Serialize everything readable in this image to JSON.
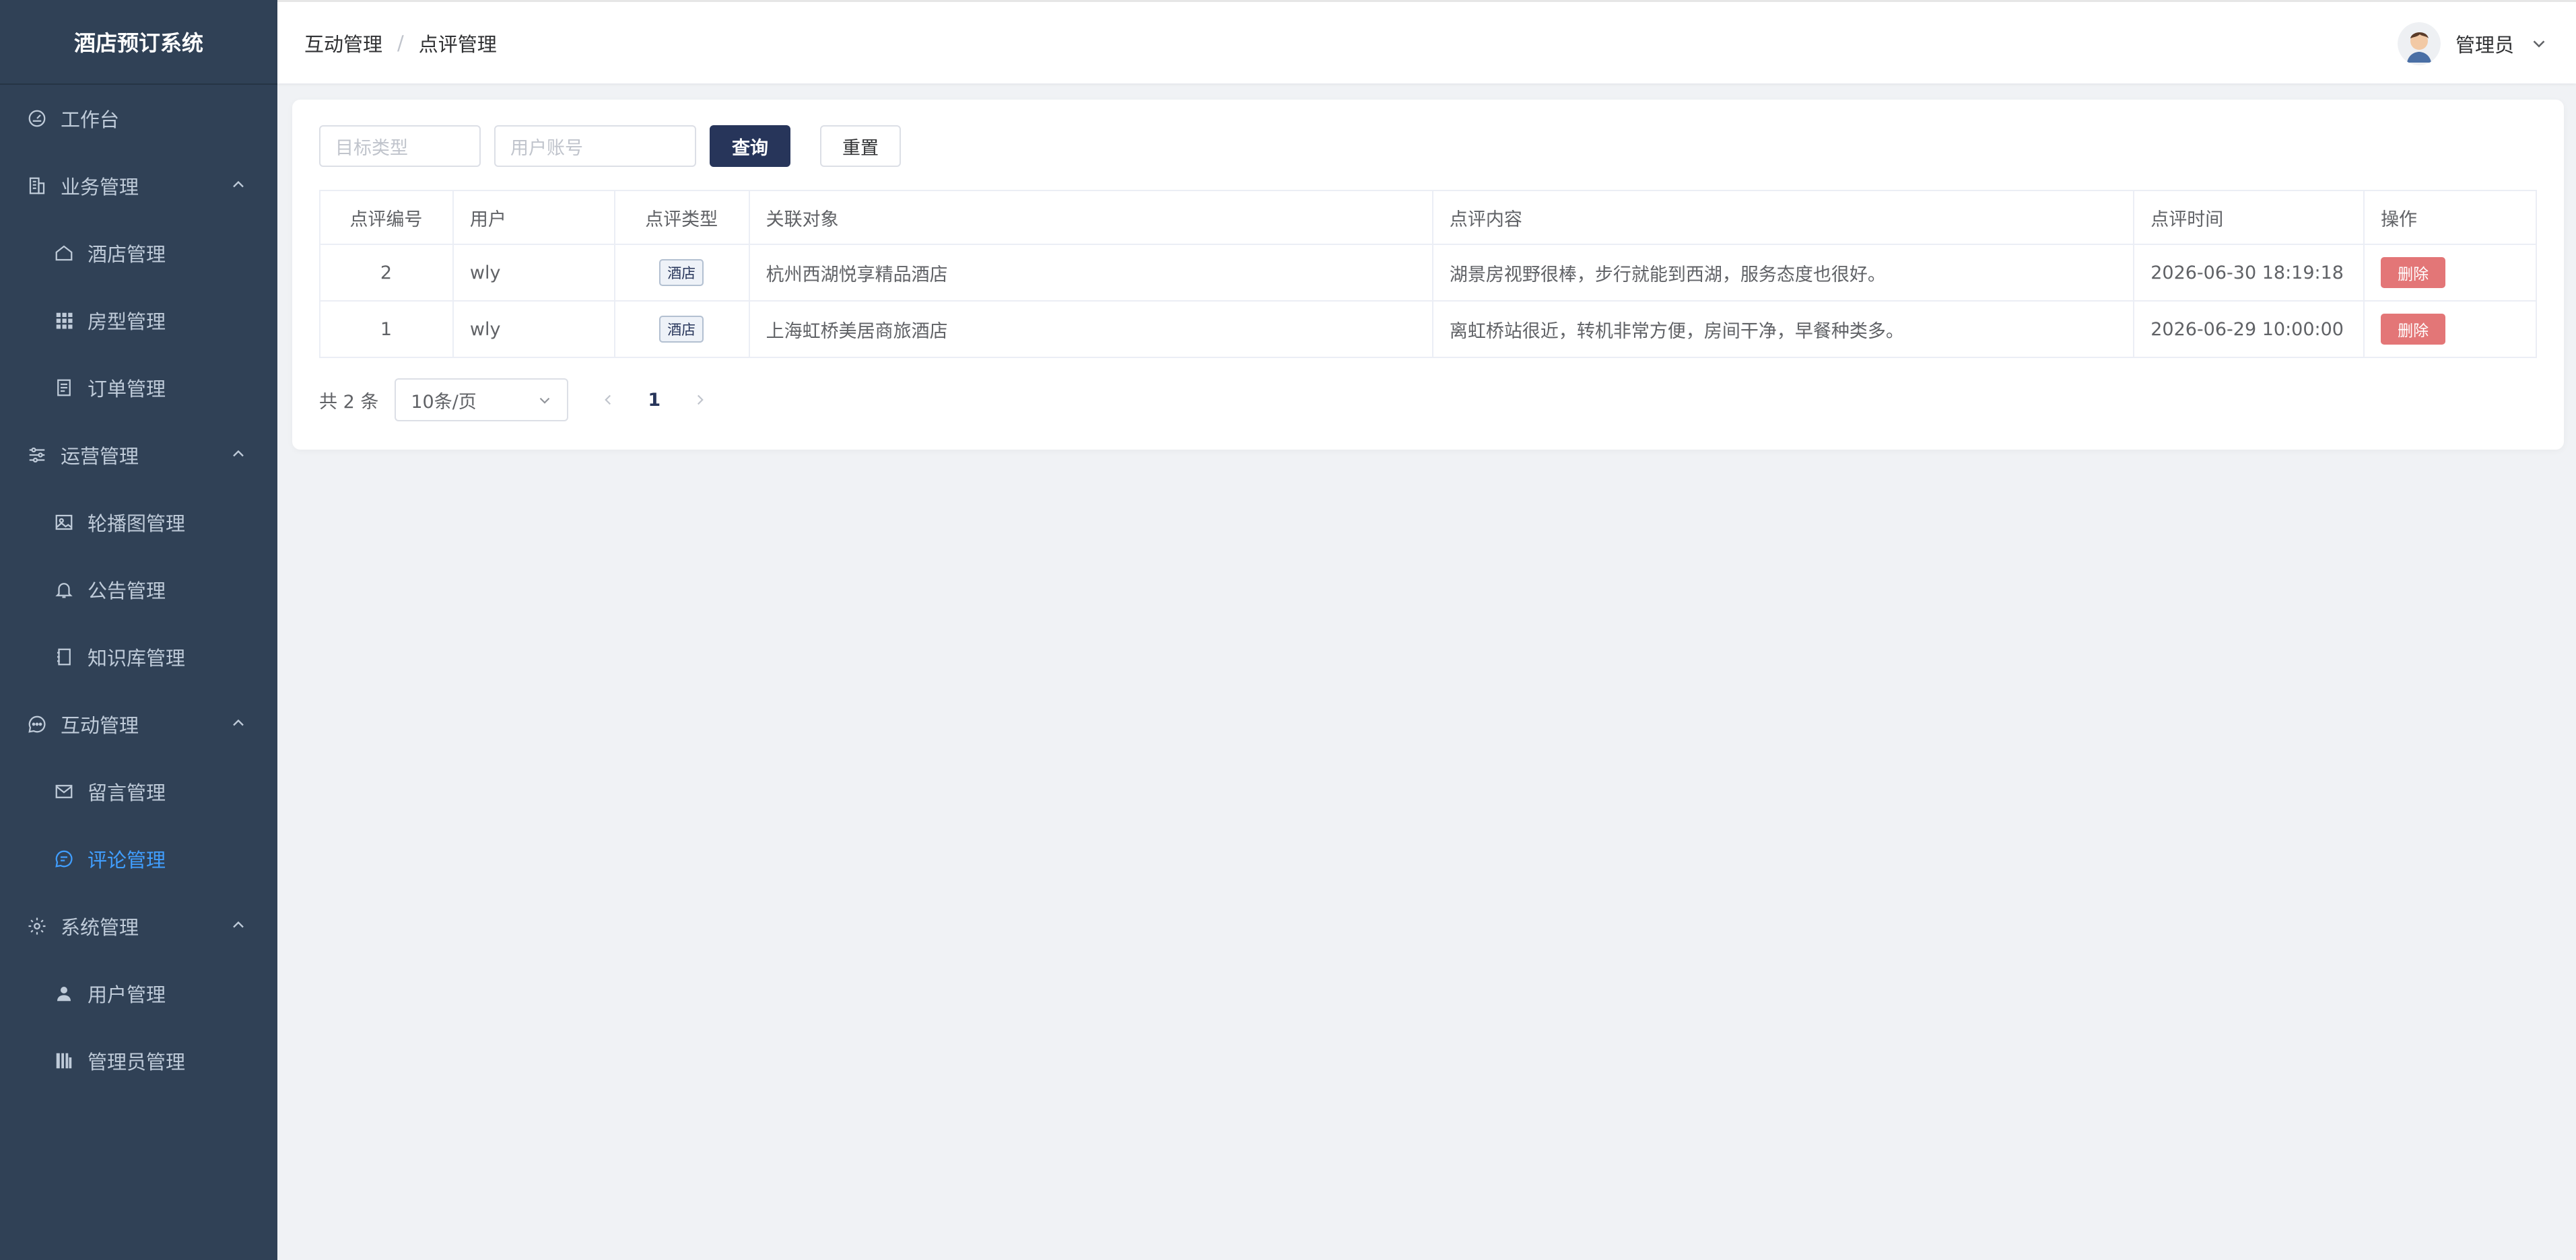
{
  "app": {
    "title": "酒店预订系统"
  },
  "sidebar": {
    "items": [
      {
        "label": "工作台",
        "icon": "dashboard-icon"
      },
      {
        "label": "业务管理",
        "icon": "building-icon",
        "expanded": true
      },
      {
        "label": "酒店管理",
        "icon": "home-icon"
      },
      {
        "label": "房型管理",
        "icon": "grid-icon"
      },
      {
        "label": "订单管理",
        "icon": "document-icon"
      },
      {
        "label": "运营管理",
        "icon": "sliders-icon",
        "expanded": true
      },
      {
        "label": "轮播图管理",
        "icon": "image-icon"
      },
      {
        "label": "公告管理",
        "icon": "bell-icon"
      },
      {
        "label": "知识库管理",
        "icon": "notebook-icon"
      },
      {
        "label": "互动管理",
        "icon": "chat-icon",
        "expanded": true
      },
      {
        "label": "留言管理",
        "icon": "mail-icon"
      },
      {
        "label": "评论管理",
        "icon": "comment-icon",
        "active": true
      },
      {
        "label": "系统管理",
        "icon": "gear-icon",
        "expanded": true
      },
      {
        "label": "用户管理",
        "icon": "user-icon"
      },
      {
        "label": "管理员管理",
        "icon": "admin-icon"
      }
    ]
  },
  "header": {
    "breadcrumb": [
      "互动管理",
      "点评管理"
    ],
    "breadcrumb_sep": "/",
    "user_name": "管理员"
  },
  "search": {
    "target_type_placeholder": "目标类型",
    "user_account_placeholder": "用户账号",
    "query_label": "查询",
    "reset_label": "重置"
  },
  "table": {
    "columns": [
      "点评编号",
      "用户",
      "点评类型",
      "关联对象",
      "点评内容",
      "点评时间",
      "操作"
    ],
    "rows": [
      {
        "id": "2",
        "user": "wly",
        "type": "酒店",
        "target": "杭州西湖悦享精品酒店",
        "content": "湖景房视野很棒，步行就能到西湖，服务态度也很好。",
        "time": "2026-06-30 18:19:18",
        "action": "删除"
      },
      {
        "id": "1",
        "user": "wly",
        "type": "酒店",
        "target": "上海虹桥美居商旅酒店",
        "content": "离虹桥站很近，转机非常方便，房间干净，早餐种类多。",
        "time": "2026-06-29 10:00:00",
        "action": "删除"
      }
    ]
  },
  "pagination": {
    "total_label": "共 2 条",
    "page_size_label": "10条/页",
    "current_page": "1"
  },
  "colors": {
    "sidebar_bg": "#304156",
    "active": "#409eff",
    "primary_button": "#27355a",
    "delete_button": "#e37677"
  }
}
